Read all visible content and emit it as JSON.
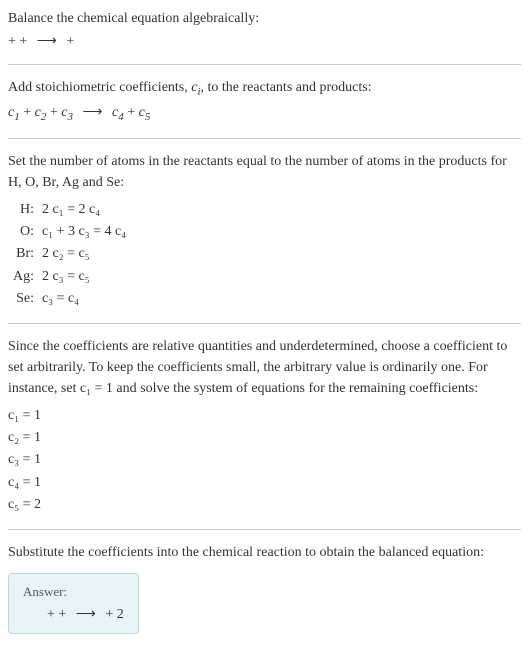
{
  "intro": {
    "line1": "Balance the chemical equation algebraically:",
    "line2_parts": [
      " + + ",
      " ⟶ ",
      " + "
    ]
  },
  "step1": {
    "text": "Add stoichiometric coefficients, ",
    "ci": "c",
    "ci_sub": "i",
    "text2": ", to the reactants and products:",
    "eq_c1": "c",
    "eq_c1s": "1",
    "eq_c2": "c",
    "eq_c2s": "2",
    "eq_c3": "c",
    "eq_c3s": "3",
    "eq_c4": "c",
    "eq_c4s": "4",
    "eq_c5": "c",
    "eq_c5s": "5",
    "plus": " + ",
    "arrow": " ⟶ "
  },
  "step2": {
    "text": "Set the number of atoms in the reactants equal to the number of atoms in the products for H, O, Br, Ag and Se:",
    "rows": [
      {
        "label": "H:",
        "eq": "2 c₁ = 2 c₄"
      },
      {
        "label": "O:",
        "eq": "c₁ + 3 c₃ = 4 c₄"
      },
      {
        "label": "Br:",
        "eq": "2 c₂ = c₅"
      },
      {
        "label": "Ag:",
        "eq": "2 c₃ = c₅"
      },
      {
        "label": "Se:",
        "eq": "c₃ = c₄"
      }
    ]
  },
  "step3": {
    "text": "Since the coefficients are relative quantities and underdetermined, choose a coefficient to set arbitrarily. To keep the coefficients small, the arbitrary value is ordinarily one. For instance, set c₁ = 1 and solve the system of equations for the remaining coefficients:",
    "coeffs": [
      "c₁ = 1",
      "c₂ = 1",
      "c₃ = 1",
      "c₄ = 1",
      "c₅ = 2"
    ]
  },
  "step4": {
    "text": "Substitute the coefficients into the chemical reaction to obtain the balanced equation:"
  },
  "answer": {
    "label": "Answer:",
    "eq_left": " + + ",
    "eq_arrow": " ⟶ ",
    "eq_right": " + 2 "
  },
  "chart_data": {
    "type": "table",
    "title": "Chemical equation balancing coefficients",
    "atom_equations": {
      "H": "2c1 = 2c4",
      "O": "c1 + 3c3 = 4c4",
      "Br": "2c2 = c5",
      "Ag": "2c3 = c5",
      "Se": "c3 = c4"
    },
    "solution": {
      "c1": 1,
      "c2": 1,
      "c3": 1,
      "c4": 1,
      "c5": 2
    }
  }
}
